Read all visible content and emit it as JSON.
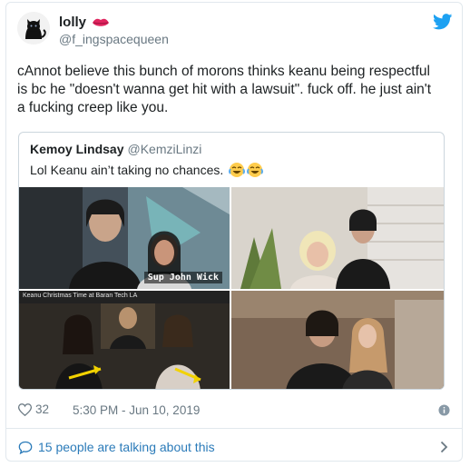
{
  "author": {
    "display_name": "lolly",
    "handle": "@f_ingspacequeen"
  },
  "tweet": {
    "text": "cAnnot believe this bunch of morons thinks keanu being respectful is bc he \"doesn't wanna get hit with a lawsuit\". fuck off. he just ain't a fucking creep like you."
  },
  "quoted": {
    "name": "Kemoy Lindsay",
    "handle": "@KemziLinzi",
    "text": "Lol Keanu ain’t taking no chances.",
    "photo1_label": "Sup John Wick",
    "photo3_caption": "Keanu Christmas Time at Baran Tech LA"
  },
  "footer": {
    "likes": "32",
    "timestamp": "5:30 PM - Jun 10, 2019"
  },
  "talk": {
    "text": "15 people are talking about this"
  },
  "colors": {
    "link": "#2b7bb9",
    "twitter_blue": "#1da1f2",
    "muted": "#697882"
  },
  "icons": [
    "cat-avatar",
    "lips-emoji",
    "twitter-bird-icon",
    "joy-emoji",
    "heart-icon",
    "info-icon",
    "comment-icon",
    "chevron-right-icon"
  ]
}
